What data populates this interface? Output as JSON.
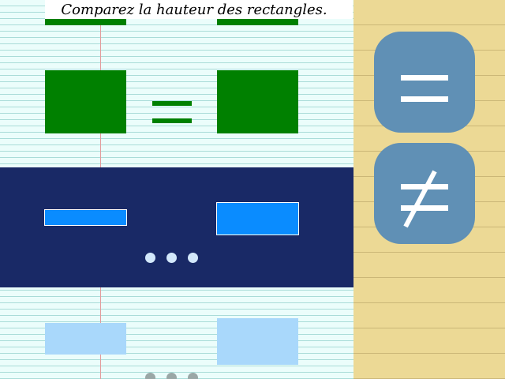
{
  "instruction": "Comparez la hauteur des rectangles.",
  "colors": {
    "correct": "#008000",
    "current_shape": "#0a8cff",
    "active_band": "#192966",
    "upcoming_shape": "#a9d8fb",
    "answer_button": "#6090b5",
    "notebook_paper": "#ebfdfb",
    "notepad_paper": "#ecd995"
  },
  "answers": {
    "equal_icon": "equals-sign-icon",
    "not_equal_icon": "not-equal-sign-icon"
  },
  "rows": {
    "solved": {
      "relation_icon": "equals-sign-icon",
      "status": "correct"
    },
    "current": {
      "relation": "pending",
      "pending_icon": "ellipsis-icon"
    },
    "upcoming": {
      "pending_icon": "ellipsis-icon"
    }
  }
}
